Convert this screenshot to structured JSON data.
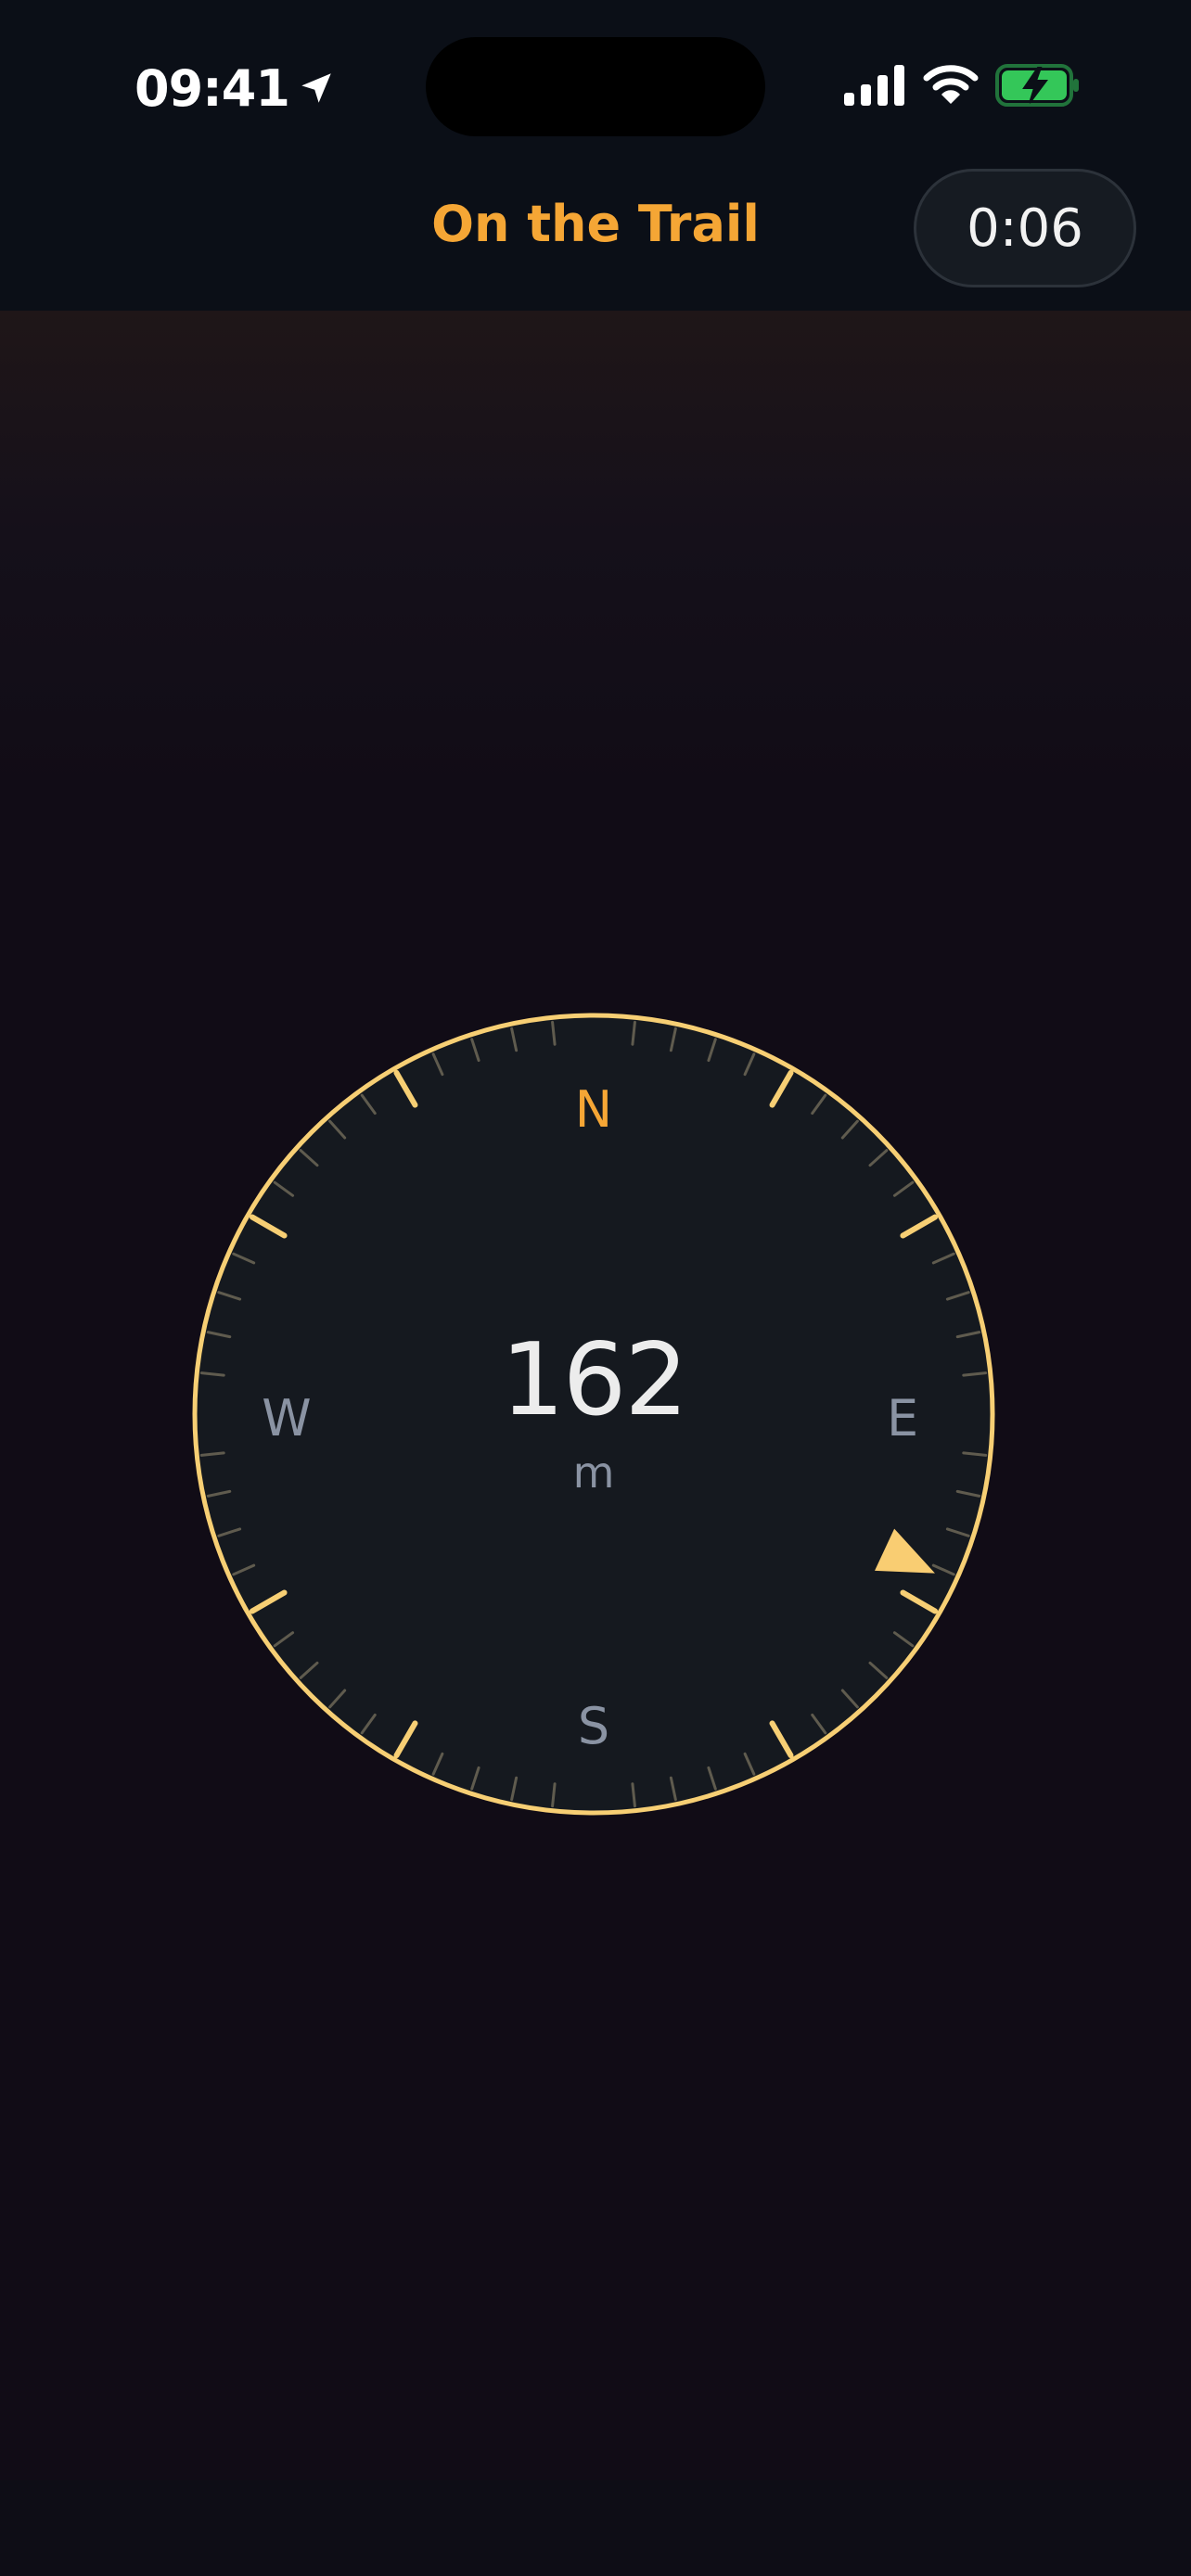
{
  "status_bar": {
    "time": "09:41",
    "icons": [
      "location-arrow-icon",
      "cellular-signal-icon",
      "wifi-icon",
      "battery-charging-icon"
    ]
  },
  "nav": {
    "title": "On the Trail",
    "timer": "0:06"
  },
  "compass": {
    "distance_value": "162",
    "distance_unit": "m",
    "cardinals": {
      "north": "N",
      "east": "E",
      "south": "S",
      "west": "W"
    },
    "pointer_bearing_deg": 115
  },
  "colors": {
    "accent": "#f5a635",
    "ring": "#f7cf74",
    "pointer": "#f9cd72",
    "dial": "#15191f",
    "background": "#110c16",
    "bar": "#0b0f17",
    "muted_text": "#8a93a3",
    "battery_green": "#34c759"
  }
}
